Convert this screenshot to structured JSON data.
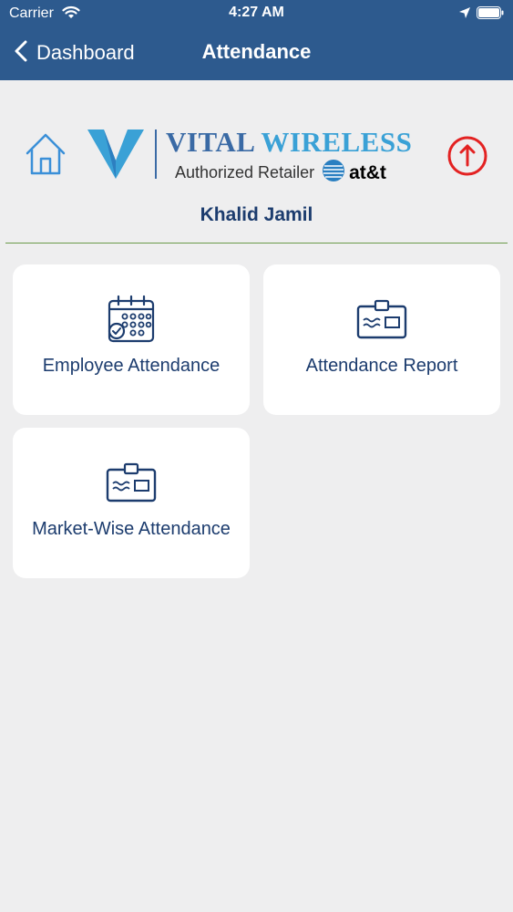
{
  "status_bar": {
    "carrier": "Carrier",
    "time": "4:27 AM"
  },
  "nav": {
    "back_label": "Dashboard",
    "title": "Attendance"
  },
  "logo": {
    "brand_part1": "VITAL ",
    "brand_part2": "WIRELESS",
    "subtitle": "Authorized Retailer",
    "partner": "at&t"
  },
  "user": {
    "name": "Khalid Jamil"
  },
  "cards": [
    {
      "label": "Employee Attendance",
      "icon": "calendar-check-icon"
    },
    {
      "label": "Attendance Report",
      "icon": "id-card-icon"
    },
    {
      "label": "Market-Wise Attendance",
      "icon": "id-card-icon"
    }
  ],
  "colors": {
    "nav_bar": "#2d5a8e",
    "background": "#eeeeef",
    "card": "#ffffff",
    "text_primary": "#1c3c6e",
    "power_icon": "#e32222",
    "home_icon": "#3a8fd8",
    "divider": "#6a9a4a"
  }
}
